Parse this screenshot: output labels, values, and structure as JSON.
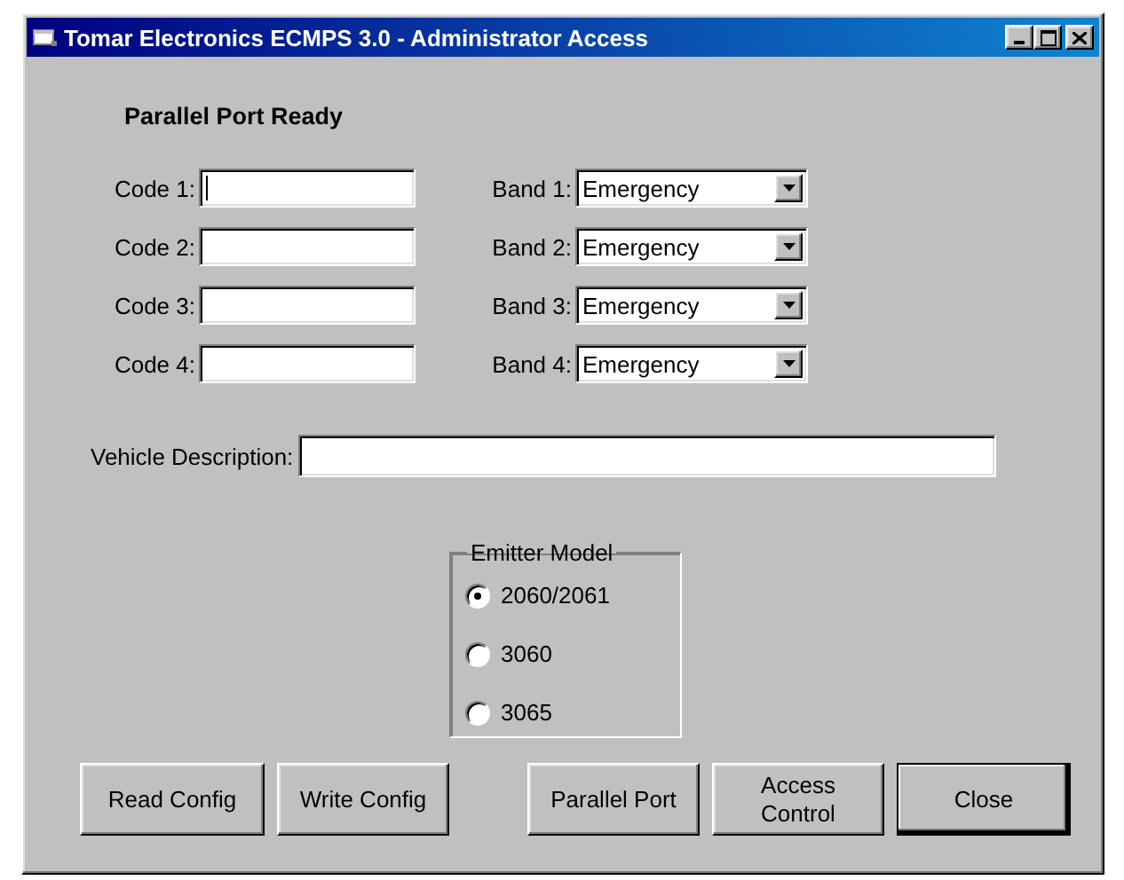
{
  "window": {
    "title": "Tomar Electronics ECMPS 3.0 - Administrator Access"
  },
  "status": "Parallel Port Ready",
  "codes": [
    {
      "label": "Code 1:",
      "focused": true
    },
    {
      "label": "Code 2:",
      "focused": false
    },
    {
      "label": "Code 3:",
      "focused": false
    },
    {
      "label": "Code 4:",
      "focused": false
    }
  ],
  "bands": [
    {
      "label": "Band 1:",
      "value": "Emergency"
    },
    {
      "label": "Band 2:",
      "value": "Emergency"
    },
    {
      "label": "Band 3:",
      "value": "Emergency"
    },
    {
      "label": "Band 4:",
      "value": "Emergency"
    }
  ],
  "vehicle_description": {
    "label": "Vehicle Description:"
  },
  "emitter_model": {
    "title": "Emitter Model",
    "options": [
      {
        "label": "2060/2061",
        "selected": true
      },
      {
        "label": "3060",
        "selected": false
      },
      {
        "label": "3065",
        "selected": false
      }
    ]
  },
  "config_buttons": [
    {
      "label": "Read Config",
      "default": false
    },
    {
      "label": "Write Config",
      "default": false
    }
  ],
  "dialog_buttons": [
    {
      "label": "Parallel Port",
      "default": false
    },
    {
      "label": "Access Control",
      "default": false
    },
    {
      "label": "Close",
      "default": true
    }
  ]
}
